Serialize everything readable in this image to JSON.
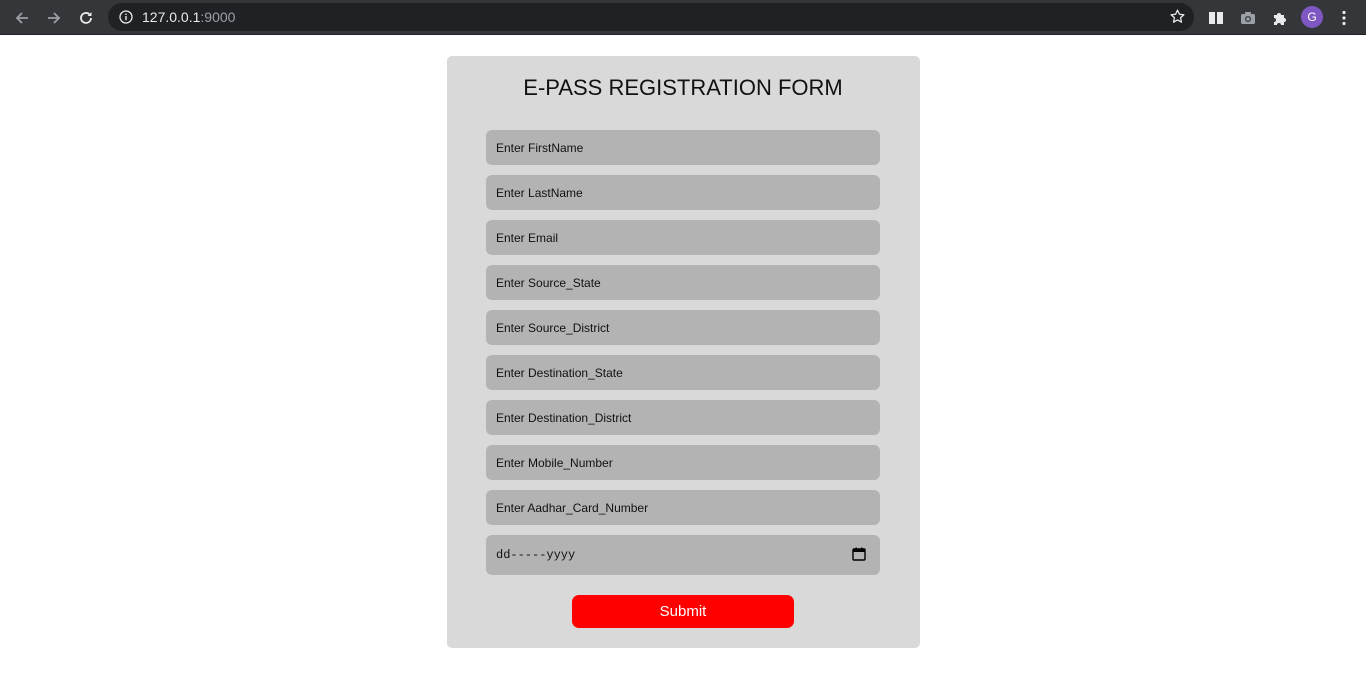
{
  "browser": {
    "url_host": "127.0.0.1",
    "url_port": ":9000",
    "profile_initial": "G",
    "icons": {
      "back": "arrow-left-icon",
      "forward": "arrow-right-icon",
      "reload": "reload-icon",
      "site_info": "info-icon",
      "bookmark": "star-icon",
      "reading_list": "reading-list-icon",
      "screenshot": "camera-icon",
      "extensions": "puzzle-icon",
      "menu": "kebab-menu-icon"
    },
    "colors": {
      "chrome_bg": "#35363a",
      "omnibox_bg": "#202124",
      "avatar_bg": "#7e57c2"
    }
  },
  "form": {
    "title": "E-PASS REGISTRATION FORM",
    "fields": {
      "first_name": "Enter FirstName",
      "last_name": "Enter LastName",
      "email": "Enter Email",
      "source_state": "Enter Source_State",
      "source_district": "Enter Source_District",
      "destination_state": "Enter Destination_State",
      "destination_district": "Enter Destination_District",
      "mobile_number": "Enter Mobile_Number",
      "aadhar_card_number": "Enter Aadhar_Card_Number"
    },
    "date_placeholder": "dd-----yyyy",
    "submit_label": "Submit",
    "colors": {
      "card_bg": "#d9d9d9",
      "field_bg": "#b3b3b3",
      "submit_bg": "#ff0000",
      "submit_text": "#ffffff"
    }
  }
}
